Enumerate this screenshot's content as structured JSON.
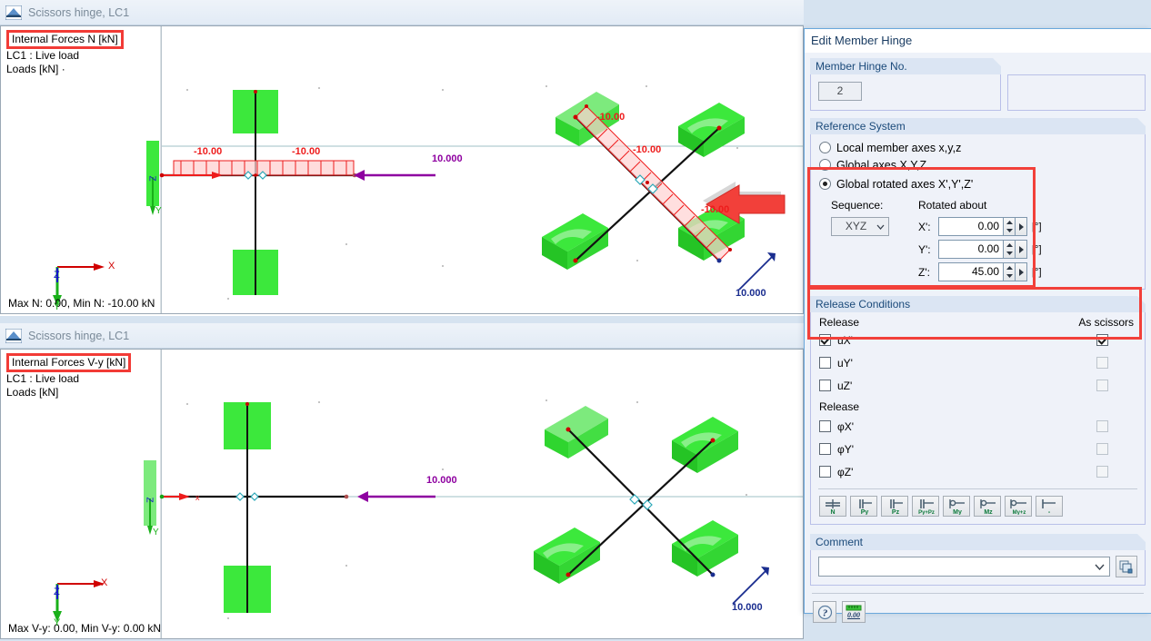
{
  "viewports": [
    {
      "title": "Scissors hinge, LC1",
      "title_icon": "structure-icon",
      "legend_title": "Internal Forces N [kN]",
      "legend_lines": [
        "LC1 : Live load",
        "Loads [kN] ·"
      ],
      "status": "Max N: 0.00, Min N: -10.00 kN",
      "labels": {
        "beam_left": "-10.00",
        "beam_right": "-10.00",
        "load_value": "10.000",
        "diag_top": "-10.00",
        "diag_mid": "-10.00",
        "diag_bottom": "-10.00",
        "diag_load_value": "10.000"
      },
      "axes": {
        "x": "X",
        "y": "Y",
        "z": "Z"
      }
    },
    {
      "title": "Scissors hinge, LC1",
      "title_icon": "structure-icon",
      "legend_title": "Internal Forces V-y [kN]",
      "legend_lines": [
        "LC1 : Live load",
        "Loads [kN]"
      ],
      "status": "Max V-y: 0.00, Min V-y: 0.00 kN",
      "labels": {
        "load_value": "10.000",
        "diag_load_value": "10.000"
      },
      "axes": {
        "x": "X",
        "y": "Y",
        "z": "Z"
      }
    }
  ],
  "dialog": {
    "title": "Edit Member Hinge",
    "hinge_no": {
      "group_label": "Member Hinge No.",
      "value": "2"
    },
    "reference_system": {
      "group_label": "Reference System",
      "options": [
        {
          "label": "Local member axes x,y,z",
          "selected": false
        },
        {
          "label": "Global axes X,Y,Z",
          "selected": false
        },
        {
          "label": "Global rotated axes X',Y',Z'",
          "selected": true
        }
      ],
      "sequence_label": "Sequence:",
      "sequence_value": "XYZ",
      "rotated_about_label": "Rotated about",
      "rotations": [
        {
          "axis": "X':",
          "value": "0.00",
          "unit": "[°]"
        },
        {
          "axis": "Y':",
          "value": "0.00",
          "unit": "[°]"
        },
        {
          "axis": "Z':",
          "value": "45.00",
          "unit": "[°]"
        }
      ]
    },
    "release_conditions": {
      "group_label": "Release Conditions",
      "release_label": "Release",
      "as_scissors_label": "As scissors",
      "translational": [
        {
          "label": "uX'",
          "released": true,
          "scissors": true,
          "scissors_enabled": true
        },
        {
          "label": "uY'",
          "released": false,
          "scissors": false,
          "scissors_enabled": false
        },
        {
          "label": "uZ'",
          "released": false,
          "scissors": false,
          "scissors_enabled": false
        }
      ],
      "release_label2": "Release",
      "rotational": [
        {
          "label": "φX'",
          "released": false,
          "scissors": false,
          "scissors_enabled": false
        },
        {
          "label": "φY'",
          "released": false,
          "scissors": false,
          "scissors_enabled": false
        },
        {
          "label": "φZ'",
          "released": false,
          "scissors": false,
          "scissors_enabled": false
        }
      ],
      "preset_buttons": [
        "N",
        "Py",
        "Pz",
        "Py+Pz",
        "My",
        "Mz",
        "My+z",
        "-"
      ]
    },
    "comment": {
      "group_label": "Comment",
      "value": "",
      "placeholder": "",
      "copy_icon": "copy-icon"
    },
    "footer": {
      "help_icon": "help-icon",
      "units_icon": "units-icon",
      "units_label": "0.00"
    }
  },
  "colors": {
    "accent_red": "#f2403a",
    "force_red": "#ee1c1c",
    "load_purple": "#8e00a0",
    "load_blue": "#1a2d8f",
    "support_green": "#3ce83c",
    "axis_x": "#d00000",
    "axis_y": "#19b019",
    "axis_z": "#1414c8",
    "dialog_bg": "#eef2f9",
    "group_header": "#dbe5f3"
  }
}
